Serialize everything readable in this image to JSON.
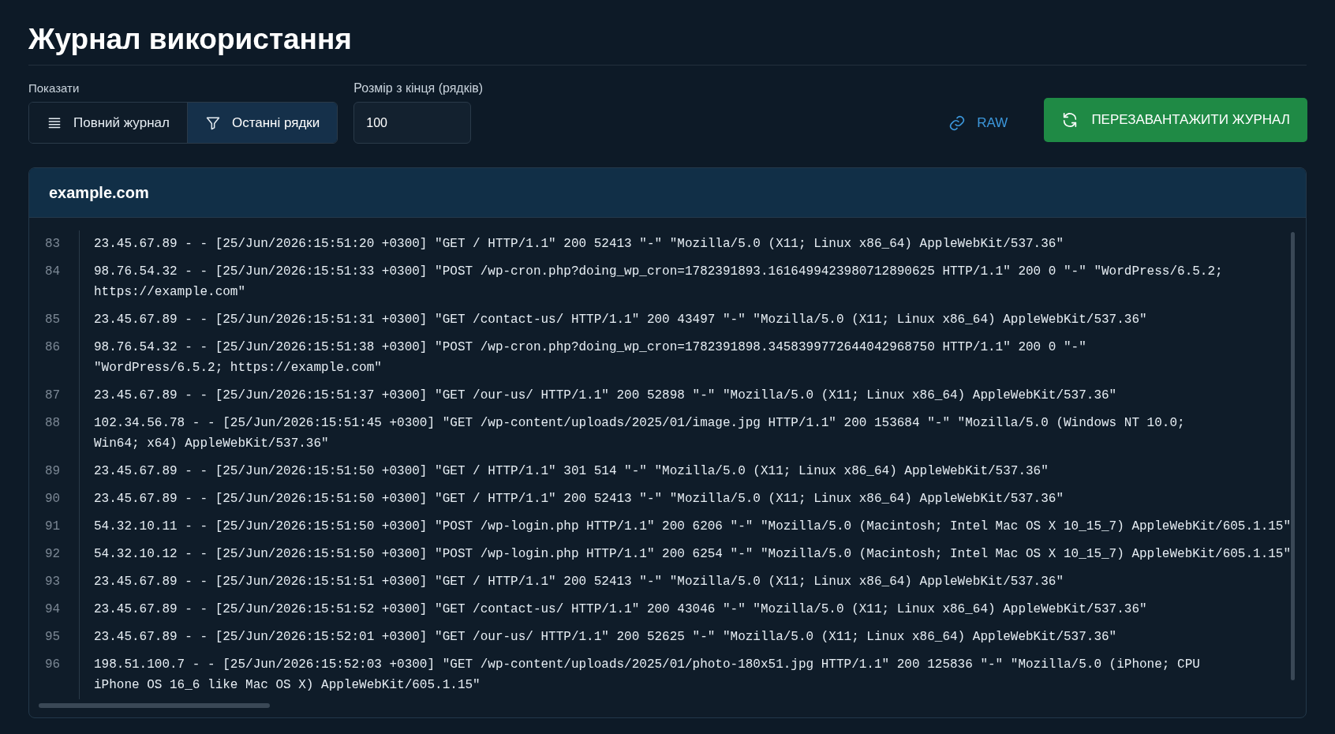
{
  "title": "Журнал використання",
  "show": {
    "label": "Показати",
    "options": [
      {
        "label": "Повний журнал",
        "selected": false
      },
      {
        "label": "Останні рядки",
        "selected": true
      }
    ]
  },
  "tail_size": {
    "label": "Розмір з кінця (рядків)",
    "value": "100"
  },
  "raw_link": "RAW",
  "reload_button": "ПЕРЕЗАВАНТАЖИТИ ЖУРНАЛ",
  "log": {
    "title": "example.com",
    "entries": [
      {
        "number": "83",
        "lines": [
          "23.45.67.89 - - [25/Jun/2026:15:51:20 +0300] \"GET / HTTP/1.1\" 200 52413 \"-\" \"Mozilla/5.0 (X11; Linux x86_64) AppleWebKit/537.36\""
        ]
      },
      {
        "number": "84",
        "lines": [
          "98.76.54.32 - - [25/Jun/2026:15:51:33 +0300] \"POST /wp-cron.php?doing_wp_cron=1782391893.1616499423980712890625 HTTP/1.1\" 200 0 \"-\" \"WordPress/6.5.2;",
          "https://example.com\""
        ]
      },
      {
        "number": "85",
        "lines": [
          "23.45.67.89 - - [25/Jun/2026:15:51:31 +0300] \"GET /contact-us/ HTTP/1.1\" 200 43497 \"-\" \"Mozilla/5.0 (X11; Linux x86_64) AppleWebKit/537.36\""
        ]
      },
      {
        "number": "86",
        "lines": [
          "98.76.54.32 - - [25/Jun/2026:15:51:38 +0300] \"POST /wp-cron.php?doing_wp_cron=1782391898.3458399772644042968750 HTTP/1.1\" 200 0 \"-\"",
          "\"WordPress/6.5.2; https://example.com\""
        ]
      },
      {
        "number": "87",
        "lines": [
          "23.45.67.89 - - [25/Jun/2026:15:51:37 +0300] \"GET /our-us/ HTTP/1.1\" 200 52898 \"-\" \"Mozilla/5.0 (X11; Linux x86_64) AppleWebKit/537.36\""
        ]
      },
      {
        "number": "88",
        "lines": [
          "102.34.56.78 - - [25/Jun/2026:15:51:45 +0300] \"GET /wp-content/uploads/2025/01/image.jpg HTTP/1.1\" 200 153684 \"-\" \"Mozilla/5.0 (Windows NT 10.0;",
          "Win64; x64) AppleWebKit/537.36\""
        ]
      },
      {
        "number": "89",
        "lines": [
          "23.45.67.89 - - [25/Jun/2026:15:51:50 +0300] \"GET / HTTP/1.1\" 301 514 \"-\" \"Mozilla/5.0 (X11; Linux x86_64) AppleWebKit/537.36\""
        ]
      },
      {
        "number": "90",
        "lines": [
          "23.45.67.89 - - [25/Jun/2026:15:51:50 +0300] \"GET / HTTP/1.1\" 200 52413 \"-\" \"Mozilla/5.0 (X11; Linux x86_64) AppleWebKit/537.36\""
        ]
      },
      {
        "number": "91",
        "lines": [
          "54.32.10.11 - - [25/Jun/2026:15:51:50 +0300] \"POST /wp-login.php HTTP/1.1\" 200 6206 \"-\" \"Mozilla/5.0 (Macintosh; Intel Mac OS X 10_15_7) AppleWebKit/605.1.15\""
        ]
      },
      {
        "number": "92",
        "lines": [
          "54.32.10.12 - - [25/Jun/2026:15:51:50 +0300] \"POST /wp-login.php HTTP/1.1\" 200 6254 \"-\" \"Mozilla/5.0 (Macintosh; Intel Mac OS X 10_15_7) AppleWebKit/605.1.15\""
        ]
      },
      {
        "number": "93",
        "lines": [
          "23.45.67.89 - - [25/Jun/2026:15:51:51 +0300] \"GET / HTTP/1.1\" 200 52413 \"-\" \"Mozilla/5.0 (X11; Linux x86_64) AppleWebKit/537.36\""
        ]
      },
      {
        "number": "94",
        "lines": [
          "23.45.67.89 - - [25/Jun/2026:15:51:52 +0300] \"GET /contact-us/ HTTP/1.1\" 200 43046 \"-\" \"Mozilla/5.0 (X11; Linux x86_64) AppleWebKit/537.36\""
        ]
      },
      {
        "number": "95",
        "lines": [
          "23.45.67.89 - - [25/Jun/2026:15:52:01 +0300] \"GET /our-us/ HTTP/1.1\" 200 52625 \"-\" \"Mozilla/5.0 (X11; Linux x86_64) AppleWebKit/537.36\""
        ]
      },
      {
        "number": "96",
        "lines": [
          "198.51.100.7 - - [25/Jun/2026:15:52:03 +0300] \"GET /wp-content/uploads/2025/01/photo-180x51.jpg HTTP/1.1\" 200 125836 \"-\" \"Mozilla/5.0 (iPhone; CPU",
          "iPhone OS 16_6 like Mac OS X) AppleWebKit/605.1.15\""
        ]
      }
    ]
  }
}
